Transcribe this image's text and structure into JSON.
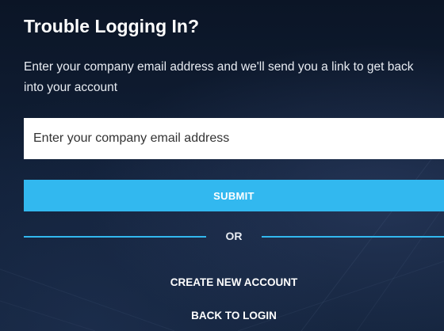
{
  "form": {
    "title": "Trouble Logging In?",
    "description": "Enter your company email address and we'll send you a link to get back into your account",
    "email_placeholder": "Enter your company email address",
    "email_value": "",
    "submit_label": "SUBMIT",
    "divider_text": "OR",
    "create_account_label": "CREATE NEW ACCOUNT",
    "back_to_login_label": "BACK TO LOGIN"
  },
  "colors": {
    "accent": "#32b8ef",
    "background": "#0d1a2e",
    "text": "#ffffff"
  }
}
